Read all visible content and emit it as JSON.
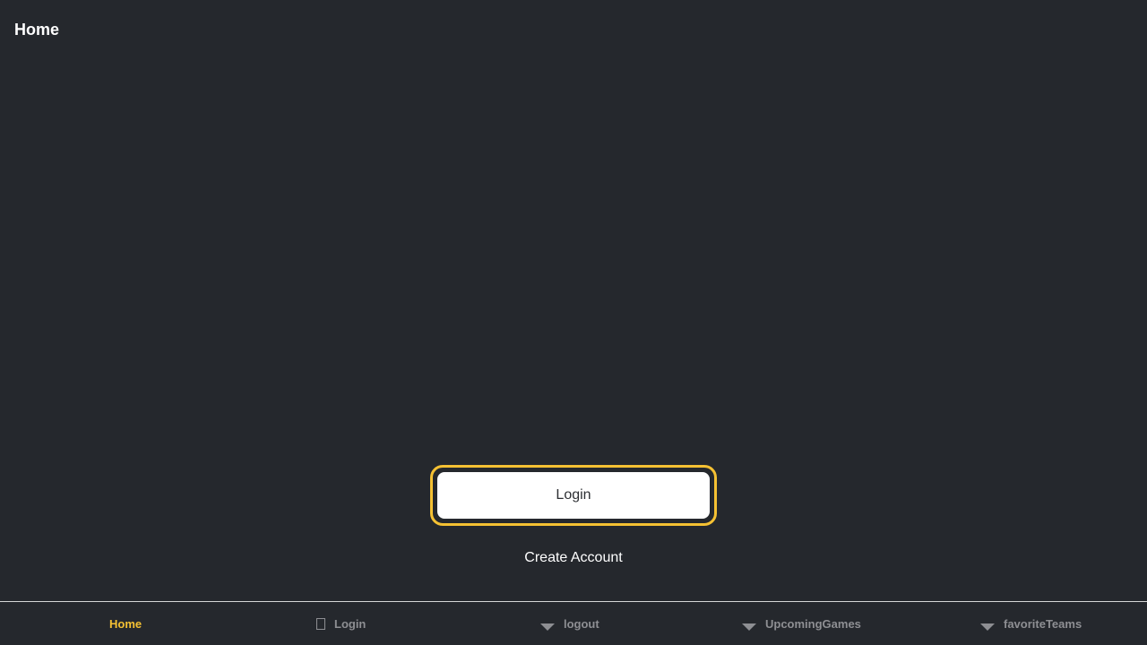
{
  "header": {
    "title": "Home"
  },
  "main": {
    "login_label": "Login",
    "create_account_label": "Create Account"
  },
  "tabs": [
    {
      "label": "Home",
      "icon": "none",
      "active": true
    },
    {
      "label": "Login",
      "icon": "square-icon",
      "active": false
    },
    {
      "label": "logout",
      "icon": "caret-down-icon",
      "active": false
    },
    {
      "label": "UpcomingGames",
      "icon": "caret-down-icon",
      "active": false
    },
    {
      "label": "favoriteTeams",
      "icon": "caret-down-icon",
      "active": false
    }
  ],
  "colors": {
    "background": "#25282d",
    "accent": "#f5c133",
    "tab_inactive": "#8e8f93",
    "text": "#ffffff"
  }
}
